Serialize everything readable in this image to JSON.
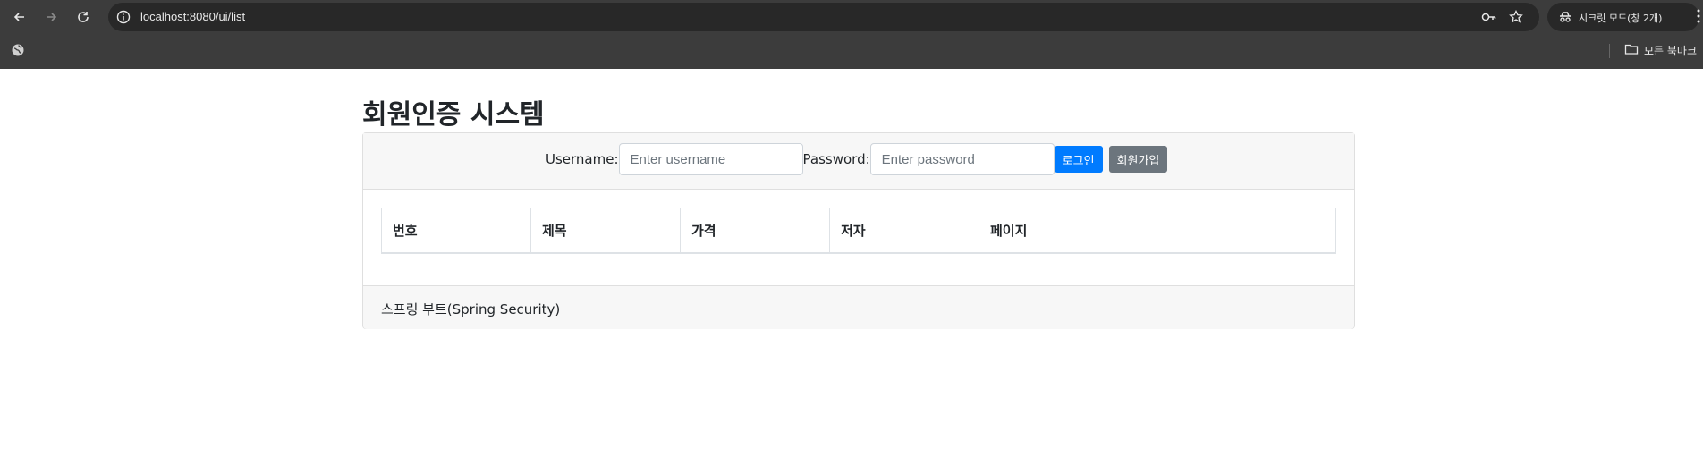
{
  "browser": {
    "url": "localhost:8080/ui/list",
    "incognito_label": "시크릿 모드(창 2개)",
    "bookmarks_all_label": "모든 북마크",
    "icons": [
      "back-icon",
      "forward-icon",
      "reload-icon",
      "info-icon",
      "key-icon",
      "star-icon",
      "incognito-icon",
      "menu-icon",
      "globe-icon",
      "folder-icon"
    ]
  },
  "page": {
    "title": "회원인증 시스템"
  },
  "login": {
    "username_label": "Username:",
    "username_placeholder": "Enter username",
    "username_value": "",
    "password_label": "Password:",
    "password_placeholder": "Enter password",
    "password_value": "",
    "login_button": "로그인",
    "signup_button": "회원가입"
  },
  "table": {
    "columns": [
      "번호",
      "제목",
      "가격",
      "저자",
      "페이지"
    ],
    "rows": []
  },
  "footer": {
    "text": "스프링 부트(Spring Security)"
  },
  "colors": {
    "primary": "#007bff",
    "secondary": "#6c757d",
    "chrome": "#3c3c3c"
  }
}
